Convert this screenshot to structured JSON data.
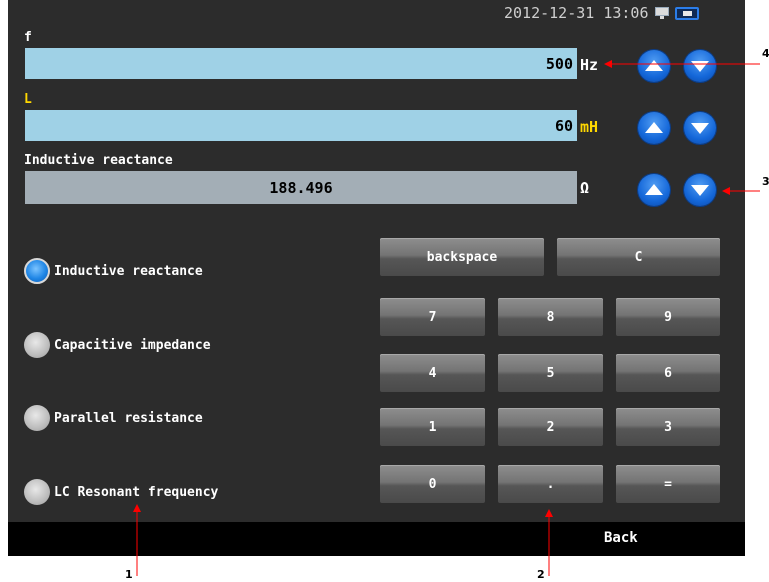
{
  "status": {
    "datetime": "2012-12-31  13:06",
    "icons": [
      "monitor-icon",
      "battery-icon"
    ]
  },
  "fields": {
    "f": {
      "label": "f",
      "value": "500",
      "unit": "Hz"
    },
    "L": {
      "label": "L",
      "value": "60",
      "unit": "mH"
    },
    "result": {
      "label": "Inductive reactance",
      "value": "188.496",
      "unit": "Ω"
    }
  },
  "modes": [
    {
      "label": "Inductive reactance",
      "selected": true
    },
    {
      "label": "Capacitive impedance",
      "selected": false
    },
    {
      "label": "Parallel resistance",
      "selected": false
    },
    {
      "label": "LC Resonant frequency",
      "selected": false
    }
  ],
  "keypad": {
    "backspace": "backspace",
    "clear": "C",
    "k7": "7",
    "k8": "8",
    "k9": "9",
    "k4": "4",
    "k5": "5",
    "k6": "6",
    "k1": "1",
    "k2": "2",
    "k3": "3",
    "k0": "0",
    "dot": ".",
    "equals": "="
  },
  "footer": {
    "back": "Back"
  },
  "annotations": {
    "a1": "1",
    "a2": "2",
    "a3": "3",
    "a4": "4"
  },
  "colors": {
    "screen_bg": "#2c2c2c",
    "input_bg": "#9fd1e6",
    "result_bg": "#a3aeb6",
    "label_yellow": "#ffd800",
    "annotation_red": "#ff0000"
  }
}
